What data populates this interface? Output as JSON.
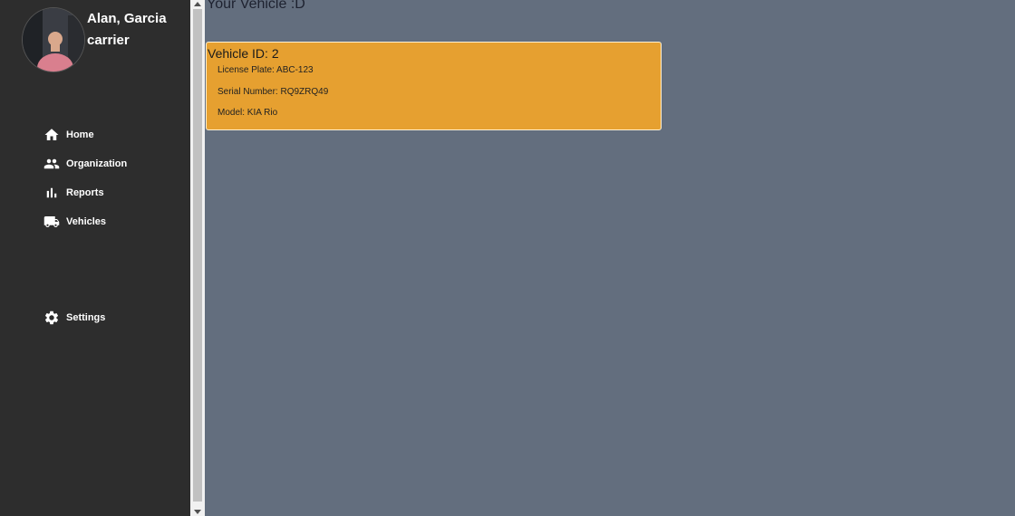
{
  "user": {
    "name": "Alan, Garcia",
    "role": "carrier"
  },
  "nav": {
    "home": "Home",
    "organization": "Organization",
    "reports": "Reports",
    "vehicles": "Vehicles",
    "settings": "Settings"
  },
  "page": {
    "title": "Your Vehicle :D"
  },
  "vehicle": {
    "title": "Vehicle ID: 2",
    "license_plate": "License Plate: ABC-123",
    "serial_number": "Serial Number: RQ9ZRQ49",
    "model": "Model: KIA Rio"
  },
  "colors": {
    "sidebar": "#2d2d2d",
    "content_bg": "#636e7e",
    "card": "#e6a030"
  }
}
